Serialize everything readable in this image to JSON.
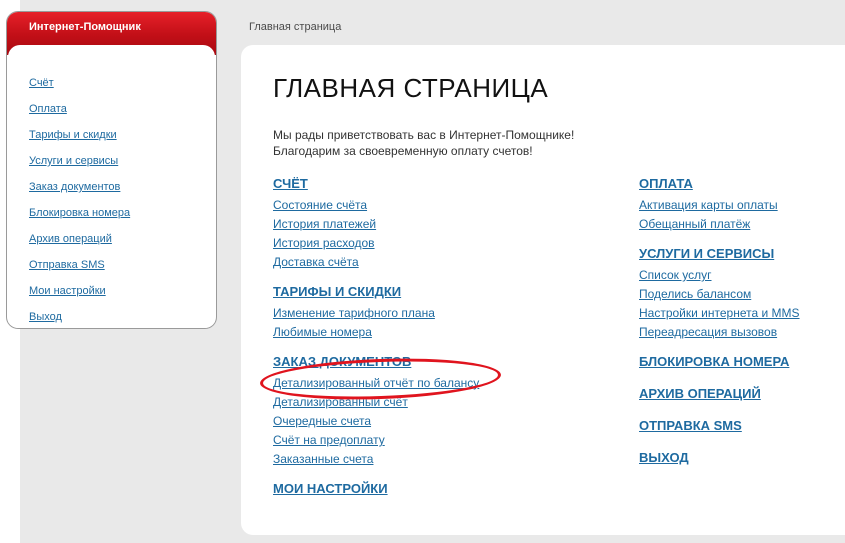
{
  "sidebar": {
    "title": "Интернет-Помощник",
    "items": [
      {
        "label": "Счёт"
      },
      {
        "label": "Оплата"
      },
      {
        "label": "Тарифы и скидки"
      },
      {
        "label": "Услуги и сервисы"
      },
      {
        "label": "Заказ документов"
      },
      {
        "label": "Блокировка номера"
      },
      {
        "label": "Архив операций"
      },
      {
        "label": "Отправка SMS"
      },
      {
        "label": "Мои настройки"
      },
      {
        "label": "Выход"
      }
    ]
  },
  "breadcrumb": "Главная страница",
  "main": {
    "title": "ГЛАВНАЯ СТРАНИЦА",
    "intro_line1": "Мы рады приветствовать вас в Интернет-Помощнике!",
    "intro_line2": "Благодарим за своевременную оплату счетов!",
    "left": {
      "account": {
        "title": "СЧЁТ",
        "links": [
          "Состояние счёта",
          "История платежей",
          "История расходов",
          "Доставка счёта"
        ]
      },
      "tariffs": {
        "title": "ТАРИФЫ И СКИДКИ",
        "links": [
          "Изменение тарифного плана",
          "Любимые номера"
        ]
      },
      "documents": {
        "title": "ЗАКАЗ ДОКУМЕНТОВ",
        "links": [
          "Детализированный отчёт по балансу",
          "Детализированный счёт",
          "Очередные счета",
          "Счёт на предоплату",
          "Заказанные счета"
        ]
      },
      "settings": {
        "title": "МОИ НАСТРОЙКИ"
      }
    },
    "right": {
      "payment": {
        "title": "ОПЛАТА",
        "links": [
          "Активация карты оплаты",
          "Обещанный платёж"
        ]
      },
      "services": {
        "title": "УСЛУГИ И СЕРВИСЫ",
        "links": [
          "Список услуг",
          "Поделись балансом",
          "Настройки интернета и MMS",
          "Переадресация вызовов"
        ]
      },
      "block": {
        "title": "БЛОКИРОВКА НОМЕРА"
      },
      "archive": {
        "title": "АРХИВ ОПЕРАЦИЙ"
      },
      "sms": {
        "title": "ОТПРАВКА SMS"
      },
      "exit": {
        "title": "ВЫХОД"
      }
    }
  },
  "colors": {
    "accent_red": "#c20f17",
    "link_blue": "#1e6aa0",
    "highlight": "#e0141e"
  }
}
